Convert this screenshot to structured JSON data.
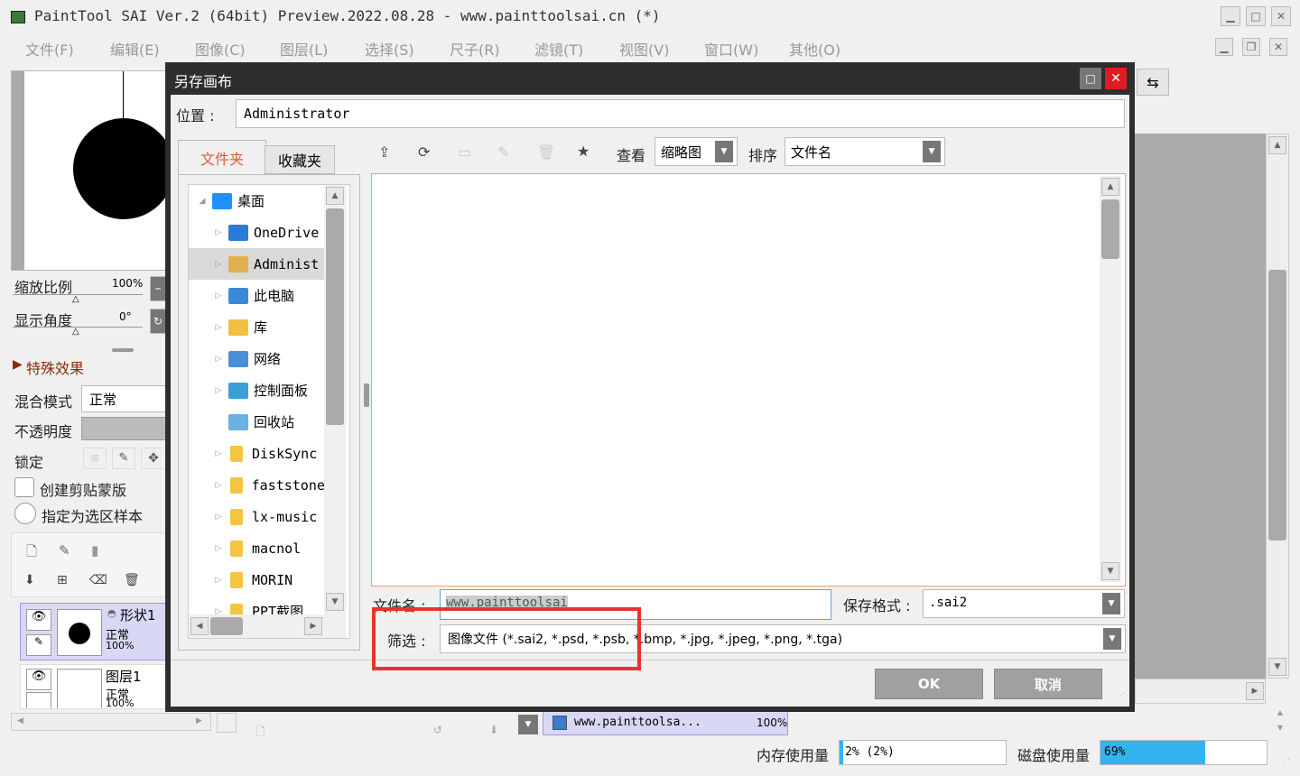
{
  "app": {
    "title": "PaintTool SAI Ver.2 (64bit) Preview.2022.08.28 - www.painttoolsai.cn (*)",
    "menu": [
      "文件(F)",
      "编辑(E)",
      "图像(C)",
      "图层(L)",
      "选择(S)",
      "尺子(R)",
      "滤镜(T)",
      "视图(V)",
      "窗口(W)",
      "其他(O)"
    ]
  },
  "left_panel": {
    "zoom_label": "缩放比例",
    "zoom_value": "100%",
    "angle_label": "显示角度",
    "angle_value": "0°",
    "special_effects": "特殊效果",
    "blend_label": "混合模式",
    "blend_value": "正常",
    "opacity_label": "不透明度",
    "lock_label": "锁定",
    "clip_label": "创建剪贴蒙版",
    "selection_sample_label": "指定为选区样本",
    "layers": [
      {
        "name": "形状1",
        "mode": "正常",
        "opacity": "100%"
      },
      {
        "name": "图层1",
        "mode": "正常",
        "opacity": "100%"
      }
    ]
  },
  "dialog": {
    "title": "另存画布",
    "location_label": "位置 :",
    "location_value": "Administrator",
    "tabs": [
      "文件夹",
      "收藏夹"
    ],
    "tree": [
      {
        "label": "桌面",
        "expanded": true,
        "icon": "desktop-icon",
        "color": "#1e90ff"
      },
      {
        "label": "OneDrive",
        "icon": "cloud-icon",
        "color": "#2b7bd8"
      },
      {
        "label": "Administ",
        "icon": "user-folder-icon",
        "color": "#e0b050",
        "selected": true
      },
      {
        "label": "此电脑",
        "icon": "computer-icon",
        "color": "#3a8ad8"
      },
      {
        "label": "库",
        "icon": "library-icon",
        "color": "#f0c040"
      },
      {
        "label": "网络",
        "icon": "network-icon",
        "color": "#4a90d8"
      },
      {
        "label": "控制面板",
        "icon": "control-panel-icon",
        "color": "#3aa0d8"
      },
      {
        "label": "回收站",
        "icon": "recycle-bin-icon",
        "color": "#6ab0e0"
      },
      {
        "label": "DiskSync",
        "icon": "folder-icon",
        "color": "#f5c542"
      },
      {
        "label": "faststone",
        "icon": "folder-icon",
        "color": "#f5c542"
      },
      {
        "label": "lx-music",
        "icon": "folder-icon",
        "color": "#f5c542"
      },
      {
        "label": "macnol",
        "icon": "folder-icon",
        "color": "#f5c542"
      },
      {
        "label": "MORIN",
        "icon": "folder-icon",
        "color": "#f5c542"
      },
      {
        "label": "PPT截图",
        "icon": "folder-icon",
        "color": "#f5c542"
      }
    ],
    "view_label": "查看",
    "view_value": "缩略图",
    "sort_label": "排序",
    "sort_value": "文件名",
    "filename_label": "文件名 :",
    "filename_value": "www.painttoolsai",
    "format_label": "保存格式 :",
    "format_value": ".sai2",
    "filter_label": "筛选 :",
    "filter_value": "图像文件 (*.sai2, *.psd, *.psb, *.bmp, *.jpg, *.jpeg, *.png, *.tga)",
    "ok_label": "OK",
    "cancel_label": "取消"
  },
  "status": {
    "doc_name": "www.painttoolsa...",
    "doc_zoom": "100%",
    "memory_label": "内存使用量",
    "memory_value": "2% (2%)",
    "memory_fraction": 0.02,
    "disk_label": "磁盘使用量",
    "disk_value": "69%",
    "disk_fraction": 0.69
  },
  "colors": {
    "highlight_box": "#e8332f",
    "disk_bar": "#33b4f0",
    "tab_active": "#e05a2a"
  }
}
